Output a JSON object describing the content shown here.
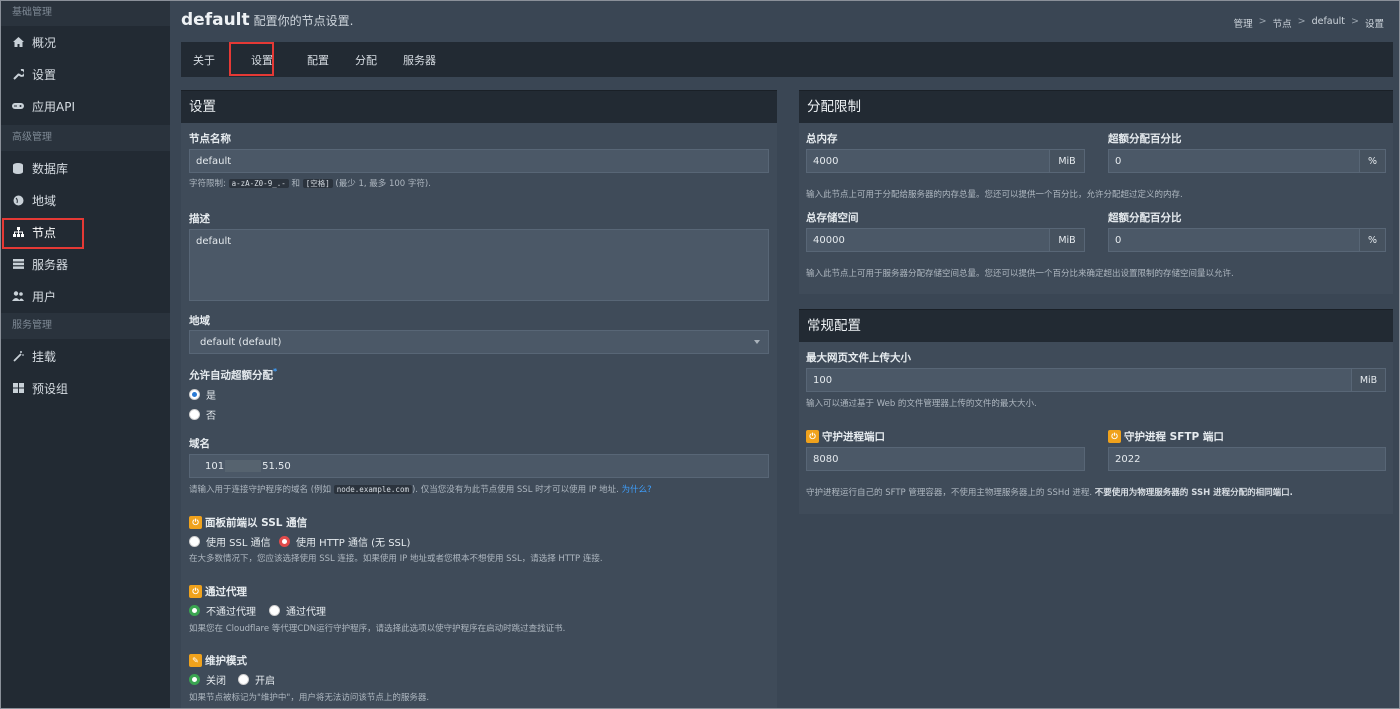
{
  "sidebar": {
    "sections": [
      {
        "title": "基础管理",
        "items": [
          {
            "label": "概况",
            "icon": "home-icon"
          },
          {
            "label": "设置",
            "icon": "wrench-icon"
          },
          {
            "label": "应用API",
            "icon": "gamepad-icon"
          }
        ]
      },
      {
        "title": "高级管理",
        "items": [
          {
            "label": "数据库",
            "icon": "database-icon"
          },
          {
            "label": "地域",
            "icon": "globe-icon"
          },
          {
            "label": "节点",
            "icon": "sitemap-icon"
          },
          {
            "label": "服务器",
            "icon": "server-icon"
          },
          {
            "label": "用户",
            "icon": "users-icon"
          }
        ]
      },
      {
        "title": "服务管理",
        "items": [
          {
            "label": "挂载",
            "icon": "magic-icon"
          },
          {
            "label": "预设组",
            "icon": "grid-icon"
          }
        ]
      }
    ],
    "active": "节点"
  },
  "header": {
    "title": "default",
    "subtitle": "配置你的节点设置."
  },
  "breadcrumb": {
    "items": [
      "管理",
      "节点",
      "default",
      "设置"
    ],
    "sep": ">"
  },
  "tabs": [
    "关于",
    "设置",
    "配置",
    "分配",
    "服务器"
  ],
  "active_tab": "设置",
  "settings": {
    "title": "设置",
    "node_name_label": "节点名称",
    "node_name_value": "default",
    "node_name_help_1": "字符限制:",
    "node_name_help_code1": "a-zA-Z0-9_.-",
    "node_name_help_and": "和",
    "node_name_help_code2": "[空格]",
    "node_name_help_2": "(最少 1, 最多 100 字符).",
    "desc_label": "描述",
    "desc_value": "default",
    "location_label": "地域",
    "location_value": "default (default)",
    "overalloc_label": "允许自动超额分配",
    "overalloc_star": "*",
    "overalloc_yes": "是",
    "overalloc_no": "否",
    "fqdn_label": "域名",
    "fqdn_value_a": "101",
    "fqdn_value_b": "51.50",
    "fqdn_help_1": "请输入用于连接守护程序的域名 (例如",
    "fqdn_help_code": "node.example.com",
    "fqdn_help_2": "). 仅当您没有为此节点使用 SSL 时才可以使用 IP 地址.",
    "fqdn_help_link": "为什么?",
    "ssl_label": "面板前端以 SSL 通信",
    "ssl_opt1": "使用 SSL 通信",
    "ssl_opt2": "使用 HTTP 通信 (无 SSL)",
    "ssl_help": "在大多数情况下，您应该选择使用 SSL 连接。如果使用 IP 地址或者您根本不想使用 SSL，请选择 HTTP 连接.",
    "proxy_label": "通过代理",
    "proxy_opt1": "不通过代理",
    "proxy_opt2": "通过代理",
    "proxy_help": "如果您在 Cloudflare 等代理CDN运行守护程序，请选择此选项以使守护程序在启动时跳过查找证书.",
    "maint_label": "维护模式",
    "maint_opt1": "关闭",
    "maint_opt2": "开启",
    "maint_help": "如果节点被标记为\"维护中\"，用户将无法访问该节点上的服务器."
  },
  "alloc": {
    "title": "分配限制",
    "mem_label": "总内存",
    "mem_value": "4000",
    "mem_unit": "MiB",
    "mem_over_label": "超额分配百分比",
    "mem_over_value": "0",
    "pct": "%",
    "mem_help": "输入此节点上可用于分配给服务器的内存总量。您还可以提供一个百分比，允许分配超过定义的内存.",
    "disk_label": "总存储空间",
    "disk_value": "40000",
    "disk_unit": "MiB",
    "disk_over_label": "超额分配百分比",
    "disk_over_value": "0",
    "disk_help": "输入此节点上可用于服务器分配存储空间总量。您还可以提供一个百分比来确定超出设置限制的存储空间量以允许."
  },
  "general": {
    "title": "常规配置",
    "upload_label": "最大网页文件上传大小",
    "upload_value": "100",
    "upload_unit": "MiB",
    "upload_help": "输入可以通过基于 Web 的文件管理器上传的文件的最大大小.",
    "daemon_port_label": "守护进程端口",
    "daemon_port_value": "8080",
    "sftp_port_label": "守护进程 SFTP 端口",
    "sftp_port_value": "2022",
    "port_help_1": "守护进程运行自己的 SFTP 管理容器，不使用主物理服务器上的 SSHd 进程.",
    "port_help_2": "不要使用为物理服务器的 SSH 进程分配的相同端口."
  }
}
